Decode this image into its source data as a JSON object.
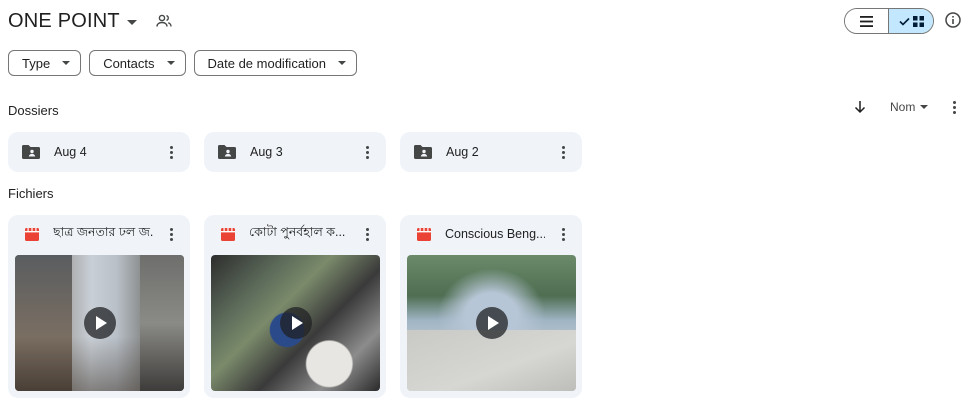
{
  "header": {
    "title": "ONE POINT"
  },
  "filters": [
    {
      "label": "Type"
    },
    {
      "label": "Contacts"
    },
    {
      "label": "Date de modification"
    }
  ],
  "sections": {
    "folders_label": "Dossiers",
    "files_label": "Fichiers"
  },
  "sort": {
    "label": "Nom"
  },
  "folders": [
    {
      "name": "Aug 4"
    },
    {
      "name": "Aug 3"
    },
    {
      "name": "Aug 2"
    }
  ],
  "files": [
    {
      "name": "ছাত্র জনতার ঢল জ..."
    },
    {
      "name": "কোটা পুনর্বহাল ক..."
    },
    {
      "name": "Conscious Beng..."
    }
  ],
  "colors": {
    "accent": "#c2e7ff",
    "card_bg": "#f0f4f9",
    "video_icon": "#ea4335"
  },
  "icons": {
    "shared": "people-icon",
    "list_view": "list-view-icon",
    "grid_view": "grid-view-icon",
    "info": "info-icon",
    "sort_direction": "arrow-down-icon",
    "folder": "shared-folder-icon",
    "video": "video-file-icon",
    "play": "play-icon"
  }
}
